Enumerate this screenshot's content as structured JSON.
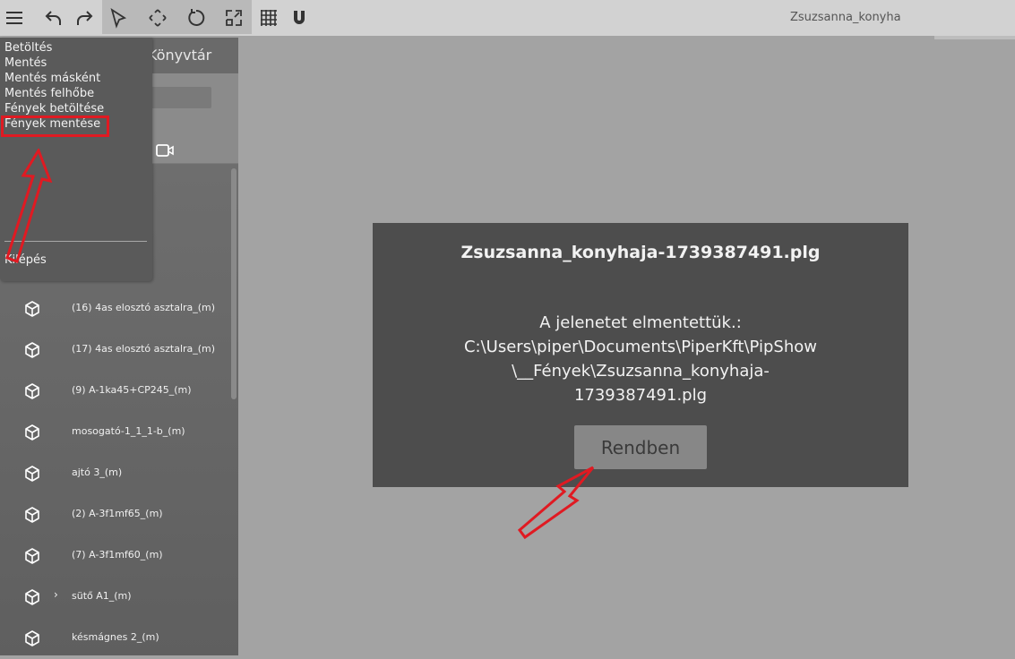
{
  "toolbar": {
    "icons": [
      "menu-icon",
      "undo-icon",
      "redo-icon",
      "select-icon",
      "move-icon",
      "rotate-icon",
      "scale-icon",
      "grid-icon",
      "magnet-icon"
    ],
    "document_title": "Zsuzsanna_konyha"
  },
  "left_panel": {
    "library_title": "Könyvtár",
    "objects": [
      {
        "label": "(16) 4as elosztó asztalra_(m)",
        "expandable": false
      },
      {
        "label": "(17) 4as elosztó asztalra_(m)",
        "expandable": false
      },
      {
        "label": "(9) A-1ka45+CP245_(m)",
        "expandable": false
      },
      {
        "label": "mosogató-1_1_1-b_(m)",
        "expandable": false
      },
      {
        "label": "ajtó 3_(m)",
        "expandable": false
      },
      {
        "label": "(2) A-3f1mf65_(m)",
        "expandable": false
      },
      {
        "label": "(7) A-3f1mf60_(m)",
        "expandable": false
      },
      {
        "label": "sütő A1_(m)",
        "expandable": true,
        "caret": "›"
      },
      {
        "label": "késmágnes 2_(m)",
        "expandable": false
      }
    ]
  },
  "file_menu": {
    "items": [
      "Betöltés",
      "Mentés",
      "Mentés másként",
      "Mentés felhőbe",
      "Fények betöltése",
      "Fények mentése"
    ],
    "highlighted_item": "Fények mentése",
    "exit_label": "Kilépés"
  },
  "dialog": {
    "title": "Zsuzsanna_konyhaja-1739387491.plg",
    "message_lines": [
      "A jelenetet elmentettük.:",
      "C:\\Users\\piper\\Documents\\PiperKft\\PipShow",
      "\\__Fények\\Zsuzsanna_konyhaja-",
      "1739387491.plg"
    ],
    "ok_label": "Rendben"
  },
  "colors": {
    "annotation_red": "#e01a22",
    "dialog_bg": "#4d4d4d",
    "canvas_bg": "#a3a3a3"
  }
}
